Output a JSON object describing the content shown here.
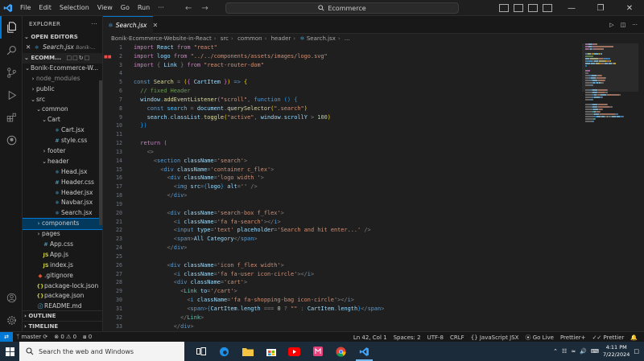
{
  "titlebar": {
    "menu": [
      "File",
      "Edit",
      "Selection",
      "View",
      "Go",
      "Run",
      "···"
    ],
    "search_text": "Ecommerce"
  },
  "tab": {
    "filename": "Search.jsx"
  },
  "breadcrumb": [
    "Bonik-Ecommerce-Website-in-React",
    "src",
    "common",
    "header",
    "Search.jsx",
    "..."
  ],
  "sidebar": {
    "title": "EXPLORER",
    "open_editors_label": "OPEN EDITORS",
    "open_editor": {
      "name": "Search.jsx",
      "path": "Bonik-..."
    },
    "folder_label": "ECOMM...",
    "outline_label": "OUTLINE",
    "timeline_label": "TIMELINE",
    "tree": [
      {
        "label": "Bonik-Ecommerce-W...",
        "chev": "⌄",
        "indent": 0,
        "icon": ""
      },
      {
        "label": "node_modules",
        "chev": "›",
        "indent": 1,
        "icon": "",
        "dim": true
      },
      {
        "label": "public",
        "chev": "›",
        "indent": 1,
        "icon": ""
      },
      {
        "label": "src",
        "chev": "⌄",
        "indent": 1,
        "icon": ""
      },
      {
        "label": "common",
        "chev": "⌄",
        "indent": 2,
        "icon": ""
      },
      {
        "label": "Cart",
        "chev": "⌄",
        "indent": 3,
        "icon": ""
      },
      {
        "label": "Cart.jsx",
        "chev": "",
        "indent": 4,
        "icon": "jsx"
      },
      {
        "label": "style.css",
        "chev": "",
        "indent": 4,
        "icon": "css"
      },
      {
        "label": "footer",
        "chev": "›",
        "indent": 3,
        "icon": ""
      },
      {
        "label": "header",
        "chev": "⌄",
        "indent": 3,
        "icon": ""
      },
      {
        "label": "Head.jsx",
        "chev": "",
        "indent": 4,
        "icon": "jsx"
      },
      {
        "label": "Header.css",
        "chev": "",
        "indent": 4,
        "icon": "css"
      },
      {
        "label": "Header.jsx",
        "chev": "",
        "indent": 4,
        "icon": "jsx"
      },
      {
        "label": "Navbar.jsx",
        "chev": "",
        "indent": 4,
        "icon": "jsx"
      },
      {
        "label": "Search.jsx",
        "chev": "",
        "indent": 4,
        "icon": "jsx"
      },
      {
        "label": "components",
        "chev": "›",
        "indent": 2,
        "icon": "",
        "selected": true
      },
      {
        "label": "pages",
        "chev": "›",
        "indent": 2,
        "icon": ""
      },
      {
        "label": "App.css",
        "chev": "",
        "indent": 2,
        "icon": "css"
      },
      {
        "label": "App.js",
        "chev": "",
        "indent": 2,
        "icon": "js"
      },
      {
        "label": "index.js",
        "chev": "",
        "indent": 2,
        "icon": "js"
      },
      {
        "label": ".gitignore",
        "chev": "",
        "indent": 1,
        "icon": "git"
      },
      {
        "label": "package-lock.json",
        "chev": "",
        "indent": 1,
        "icon": "json"
      },
      {
        "label": "package.json",
        "chev": "",
        "indent": 1,
        "icon": "json"
      },
      {
        "label": "README.md",
        "chev": "",
        "indent": 1,
        "icon": "md"
      }
    ]
  },
  "editor": {
    "lines": [
      [
        [
          "kw",
          "import"
        ],
        [
          "vr",
          " React "
        ],
        [
          "kw",
          "from"
        ],
        [
          "st",
          " \"react\""
        ]
      ],
      [
        [
          "kw",
          "import"
        ],
        [
          "vr",
          " logo "
        ],
        [
          "kw",
          "from"
        ],
        [
          "st",
          " \"../../components/assets/images/logo.svg\""
        ]
      ],
      [
        [
          "kw",
          "import"
        ],
        [
          "pc",
          " { "
        ],
        [
          "vr",
          "Link"
        ],
        [
          "pc",
          " } "
        ],
        [
          "kw",
          "from"
        ],
        [
          "st",
          " \"react-router-dom\""
        ]
      ],
      [],
      [
        [
          "kb",
          "const"
        ],
        [
          "fn",
          " Search"
        ],
        [
          "pc",
          " = "
        ],
        [
          "br",
          "("
        ],
        [
          "br2",
          "{ "
        ],
        [
          "vr",
          "CartItem"
        ],
        [
          "br2",
          " }"
        ],
        [
          "br",
          ")"
        ],
        [
          "kb",
          " =>"
        ],
        [
          "br",
          " {"
        ]
      ],
      [
        [
          "cm",
          "  // fixed Header"
        ]
      ],
      [
        [
          "vr",
          "  window"
        ],
        [
          "pc",
          "."
        ],
        [
          "fn",
          "addEventListener"
        ],
        [
          "br2",
          "("
        ],
        [
          "st",
          "\"scroll\""
        ],
        [
          "pc",
          ", "
        ],
        [
          "kb",
          "function"
        ],
        [
          "br3",
          " () {"
        ]
      ],
      [
        [
          "kb",
          "    const"
        ],
        [
          "cn",
          " search"
        ],
        [
          "pc",
          " = "
        ],
        [
          "vr",
          "document"
        ],
        [
          "pc",
          "."
        ],
        [
          "fn",
          "querySelector"
        ],
        [
          "br",
          "("
        ],
        [
          "st",
          "\".search\""
        ],
        [
          "br",
          ")"
        ]
      ],
      [
        [
          "vr",
          "    search"
        ],
        [
          "pc",
          "."
        ],
        [
          "vr",
          "classList"
        ],
        [
          "pc",
          "."
        ],
        [
          "fn",
          "toggle"
        ],
        [
          "br",
          "("
        ],
        [
          "st",
          "\"active\""
        ],
        [
          "pc",
          ", "
        ],
        [
          "vr",
          "window"
        ],
        [
          "pc",
          "."
        ],
        [
          "vr",
          "scrollY"
        ],
        [
          "pc",
          " > "
        ],
        [
          "nm",
          "100"
        ],
        [
          "br",
          ")"
        ]
      ],
      [
        [
          "br3",
          "  })"
        ]
      ],
      [],
      [
        [
          "kw",
          "  return"
        ],
        [
          "br2",
          " ("
        ]
      ],
      [
        [
          "pc",
          "    <>"
        ]
      ],
      [
        [
          "pc",
          "      <"
        ],
        [
          "tg",
          "section"
        ],
        [
          "vr",
          " className"
        ],
        [
          "pc",
          "="
        ],
        [
          "st",
          "'search'"
        ],
        [
          "pc",
          ">"
        ]
      ],
      [
        [
          "pc",
          "        <"
        ],
        [
          "tg",
          "div"
        ],
        [
          "vr",
          " className"
        ],
        [
          "pc",
          "="
        ],
        [
          "st",
          "'container c_flex'"
        ],
        [
          "pc",
          ">"
        ]
      ],
      [
        [
          "pc",
          "          <"
        ],
        [
          "tg",
          "div"
        ],
        [
          "vr",
          " className"
        ],
        [
          "pc",
          "="
        ],
        [
          "st",
          "'logo width '"
        ],
        [
          "pc",
          ">"
        ]
      ],
      [
        [
          "pc",
          "            <"
        ],
        [
          "tg",
          "img"
        ],
        [
          "vr",
          " src"
        ],
        [
          "pc",
          "="
        ],
        [
          "br3",
          "{"
        ],
        [
          "vr",
          "logo"
        ],
        [
          "br3",
          "}"
        ],
        [
          "vr",
          " alt"
        ],
        [
          "pc",
          "="
        ],
        [
          "st",
          "''"
        ],
        [
          "pc",
          " />"
        ]
      ],
      [
        [
          "pc",
          "          </"
        ],
        [
          "tg",
          "div"
        ],
        [
          "pc",
          ">"
        ]
      ],
      [],
      [
        [
          "pc",
          "          <"
        ],
        [
          "tg",
          "div"
        ],
        [
          "vr",
          " className"
        ],
        [
          "pc",
          "="
        ],
        [
          "st",
          "'search-box f_flex'"
        ],
        [
          "pc",
          ">"
        ]
      ],
      [
        [
          "pc",
          "            <"
        ],
        [
          "tg",
          "i"
        ],
        [
          "vr",
          " className"
        ],
        [
          "pc",
          "="
        ],
        [
          "st",
          "'fa fa-search'"
        ],
        [
          "pc",
          "></"
        ],
        [
          "tg",
          "i"
        ],
        [
          "pc",
          ">"
        ]
      ],
      [
        [
          "pc",
          "            <"
        ],
        [
          "tg",
          "input"
        ],
        [
          "vr",
          " type"
        ],
        [
          "pc",
          "="
        ],
        [
          "st",
          "'text'"
        ],
        [
          "vr",
          " placeholder"
        ],
        [
          "pc",
          "="
        ],
        [
          "st",
          "'Search and hit enter...'"
        ],
        [
          "pc",
          " />"
        ]
      ],
      [
        [
          "pc",
          "            <"
        ],
        [
          "tg",
          "span"
        ],
        [
          "pc",
          ">"
        ],
        [
          "vr",
          "All Category"
        ],
        [
          "pc",
          "</"
        ],
        [
          "tg",
          "span"
        ],
        [
          "pc",
          ">"
        ]
      ],
      [
        [
          "pc",
          "          </"
        ],
        [
          "tg",
          "div"
        ],
        [
          "pc",
          ">"
        ]
      ],
      [],
      [
        [
          "pc",
          "          <"
        ],
        [
          "tg",
          "div"
        ],
        [
          "vr",
          " className"
        ],
        [
          "pc",
          "="
        ],
        [
          "st",
          "'icon f_flex width'"
        ],
        [
          "pc",
          ">"
        ]
      ],
      [
        [
          "pc",
          "            <"
        ],
        [
          "tg",
          "i"
        ],
        [
          "vr",
          " className"
        ],
        [
          "pc",
          "="
        ],
        [
          "st",
          "'fa fa-user icon-circle'"
        ],
        [
          "pc",
          "></"
        ],
        [
          "tg",
          "i"
        ],
        [
          "pc",
          ">"
        ]
      ],
      [
        [
          "pc",
          "            <"
        ],
        [
          "tg",
          "div"
        ],
        [
          "vr",
          " className"
        ],
        [
          "pc",
          "="
        ],
        [
          "st",
          "'cart'"
        ],
        [
          "pc",
          ">"
        ]
      ],
      [
        [
          "pc",
          "              <"
        ],
        [
          "cp",
          "Link"
        ],
        [
          "vr",
          " to"
        ],
        [
          "pc",
          "="
        ],
        [
          "st",
          "'/cart'"
        ],
        [
          "pc",
          ">"
        ]
      ],
      [
        [
          "pc",
          "                <"
        ],
        [
          "tg",
          "i"
        ],
        [
          "vr",
          " className"
        ],
        [
          "pc",
          "="
        ],
        [
          "st",
          "'fa fa-shopping-bag icon-circle'"
        ],
        [
          "pc",
          "></"
        ],
        [
          "tg",
          "i"
        ],
        [
          "pc",
          ">"
        ]
      ],
      [
        [
          "pc",
          "                <"
        ],
        [
          "tg",
          "span"
        ],
        [
          "pc",
          ">"
        ],
        [
          "br3",
          "{"
        ],
        [
          "vr",
          "CartItem"
        ],
        [
          "pc",
          "."
        ],
        [
          "vr",
          "length"
        ],
        [
          "pc",
          " === "
        ],
        [
          "nm",
          "0"
        ],
        [
          "pc",
          " ? "
        ],
        [
          "st",
          "\"\""
        ],
        [
          "pc",
          " : "
        ],
        [
          "vr",
          "CartItem"
        ],
        [
          "pc",
          "."
        ],
        [
          "vr",
          "length"
        ],
        [
          "br3",
          "}"
        ],
        [
          "pc",
          "</"
        ],
        [
          "tg",
          "span"
        ],
        [
          "pc",
          ">"
        ]
      ],
      [
        [
          "pc",
          "              </"
        ],
        [
          "cp",
          "Link"
        ],
        [
          "pc",
          ">"
        ]
      ],
      [
        [
          "pc",
          "            </"
        ],
        [
          "tg",
          "div"
        ],
        [
          "pc",
          ">"
        ]
      ]
    ]
  },
  "statusbar": {
    "branch": "master",
    "errors": "0",
    "warnings": "0",
    "ports": "0",
    "position": "Ln 42, Col 1",
    "spaces": "Spaces: 2",
    "encoding": "UTF-8",
    "eol": "CRLF",
    "language": "JavaScript JSX",
    "golive": "Go Live",
    "prettier_plus": "Prettier+",
    "prettier": "Prettier"
  },
  "taskbar": {
    "search_placeholder": "Search the web and Windows",
    "time": "4:11 PM",
    "date": "7/22/2024"
  },
  "colors": {
    "accent": "#0078d4",
    "editor_bg": "#1f1f1f",
    "taskbar_bg": "#1c2b3a"
  }
}
